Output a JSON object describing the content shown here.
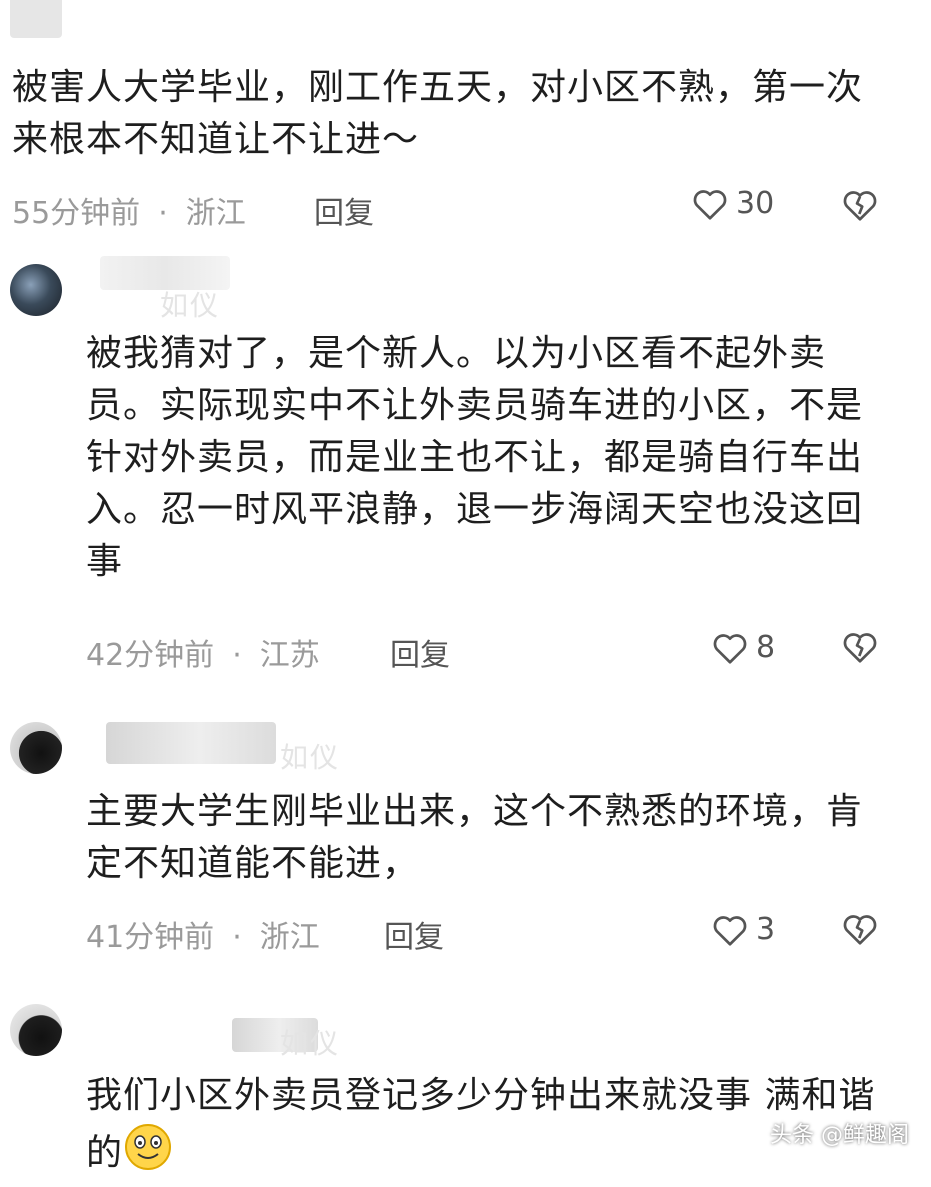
{
  "comments": [
    {
      "text": "被害人大学毕业，刚工作五天，对小区不熟，第一次来根本不知道让不让进～",
      "time": "55分钟前",
      "region": "浙江",
      "reply_label": "回复",
      "likes": "30"
    },
    {
      "name_fragment": "如仪",
      "text": "被我猜对了，是个新人。以为小区看不起外卖员。实际现实中不让外卖员骑车进的小区，不是针对外卖员，而是业主也不让，都是骑自行车出入。忍一时风平浪静，退一步海阔天空也没这回事",
      "time": "42分钟前",
      "region": "江苏",
      "reply_label": "回复",
      "likes": "8"
    },
    {
      "name_fragment": "如仪",
      "text": "主要大学生刚毕业出来，这个不熟悉的环境，肯定不知道能不能进，",
      "time": "41分钟前",
      "region": "浙江",
      "reply_label": "回复",
      "likes": "3"
    },
    {
      "name_fragment": "如仪",
      "text": "我们小区外卖员登记多少分钟出来就没事  满和谐的",
      "emoji_icon": "smiling-face-emoji-icon"
    }
  ],
  "separator": "·",
  "watermark": "头条 @鲜趣阁",
  "icons": {
    "like": "heart-outline-icon",
    "dislike": "broken-heart-icon"
  },
  "colors": {
    "text": "#1e1e1e",
    "meta": "#9a9a9a",
    "icon": "#555555",
    "background": "#ffffff"
  }
}
